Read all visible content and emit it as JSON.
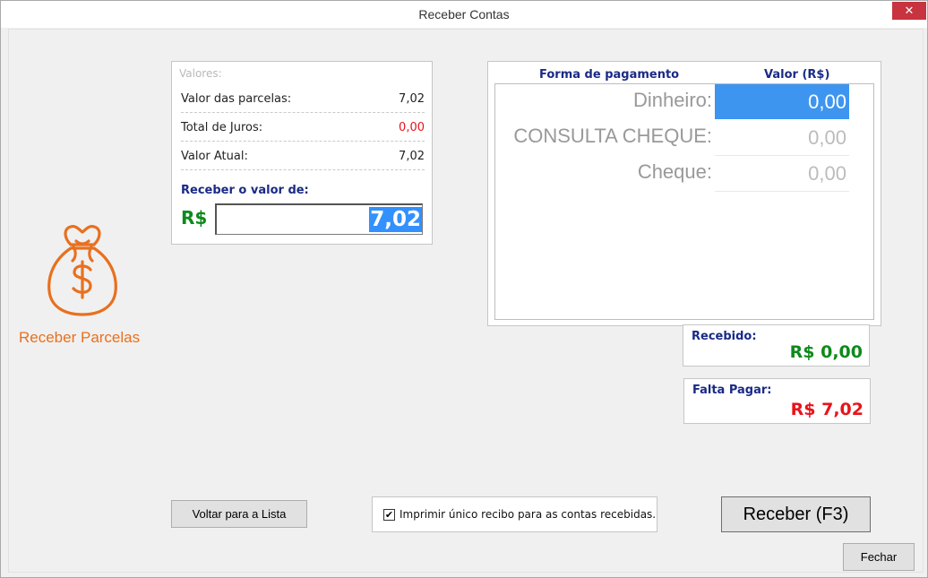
{
  "window": {
    "title": "Receber Contas",
    "close_glyph": "✕"
  },
  "sidebar": {
    "icon": "money-bag-icon",
    "caption": "Receber Parcelas"
  },
  "values": {
    "header": "Valores:",
    "rows": [
      {
        "label": "Valor das parcelas:",
        "value": "7,02"
      },
      {
        "label": "Total de Juros:",
        "value": "0,00"
      },
      {
        "label": "Valor Atual:",
        "value": "7,02"
      }
    ],
    "receive_label": "Receber o valor de:",
    "currency": "R$",
    "amount": "7,02"
  },
  "payment": {
    "col_method": "Forma de pagamento",
    "col_value": "Valor (R$)",
    "rows": [
      {
        "method": "Dinheiro:",
        "value": "0,00",
        "selected": true
      },
      {
        "method": "CONSULTA CHEQUE:",
        "value": "0,00",
        "selected": false
      },
      {
        "method": "Cheque:",
        "value": "0,00",
        "selected": false
      }
    ]
  },
  "summary": {
    "received_label": "Recebido:",
    "received_value": "R$ 0,00",
    "remaining_label": "Falta Pagar:",
    "remaining_value": "R$ 7,02"
  },
  "actions": {
    "back_label": "Voltar para a Lista",
    "print_label": "Imprimir único recibo para as contas recebidas.",
    "print_checked": true,
    "receive_label": "Receber (F3)",
    "close_label": "Fechar"
  },
  "colors": {
    "accent_orange": "#e8701f",
    "label_blue": "#1a2a86",
    "positive_green": "#0d8a1b",
    "negative_red": "#e8131b",
    "selection_blue": "#3d95f0"
  }
}
